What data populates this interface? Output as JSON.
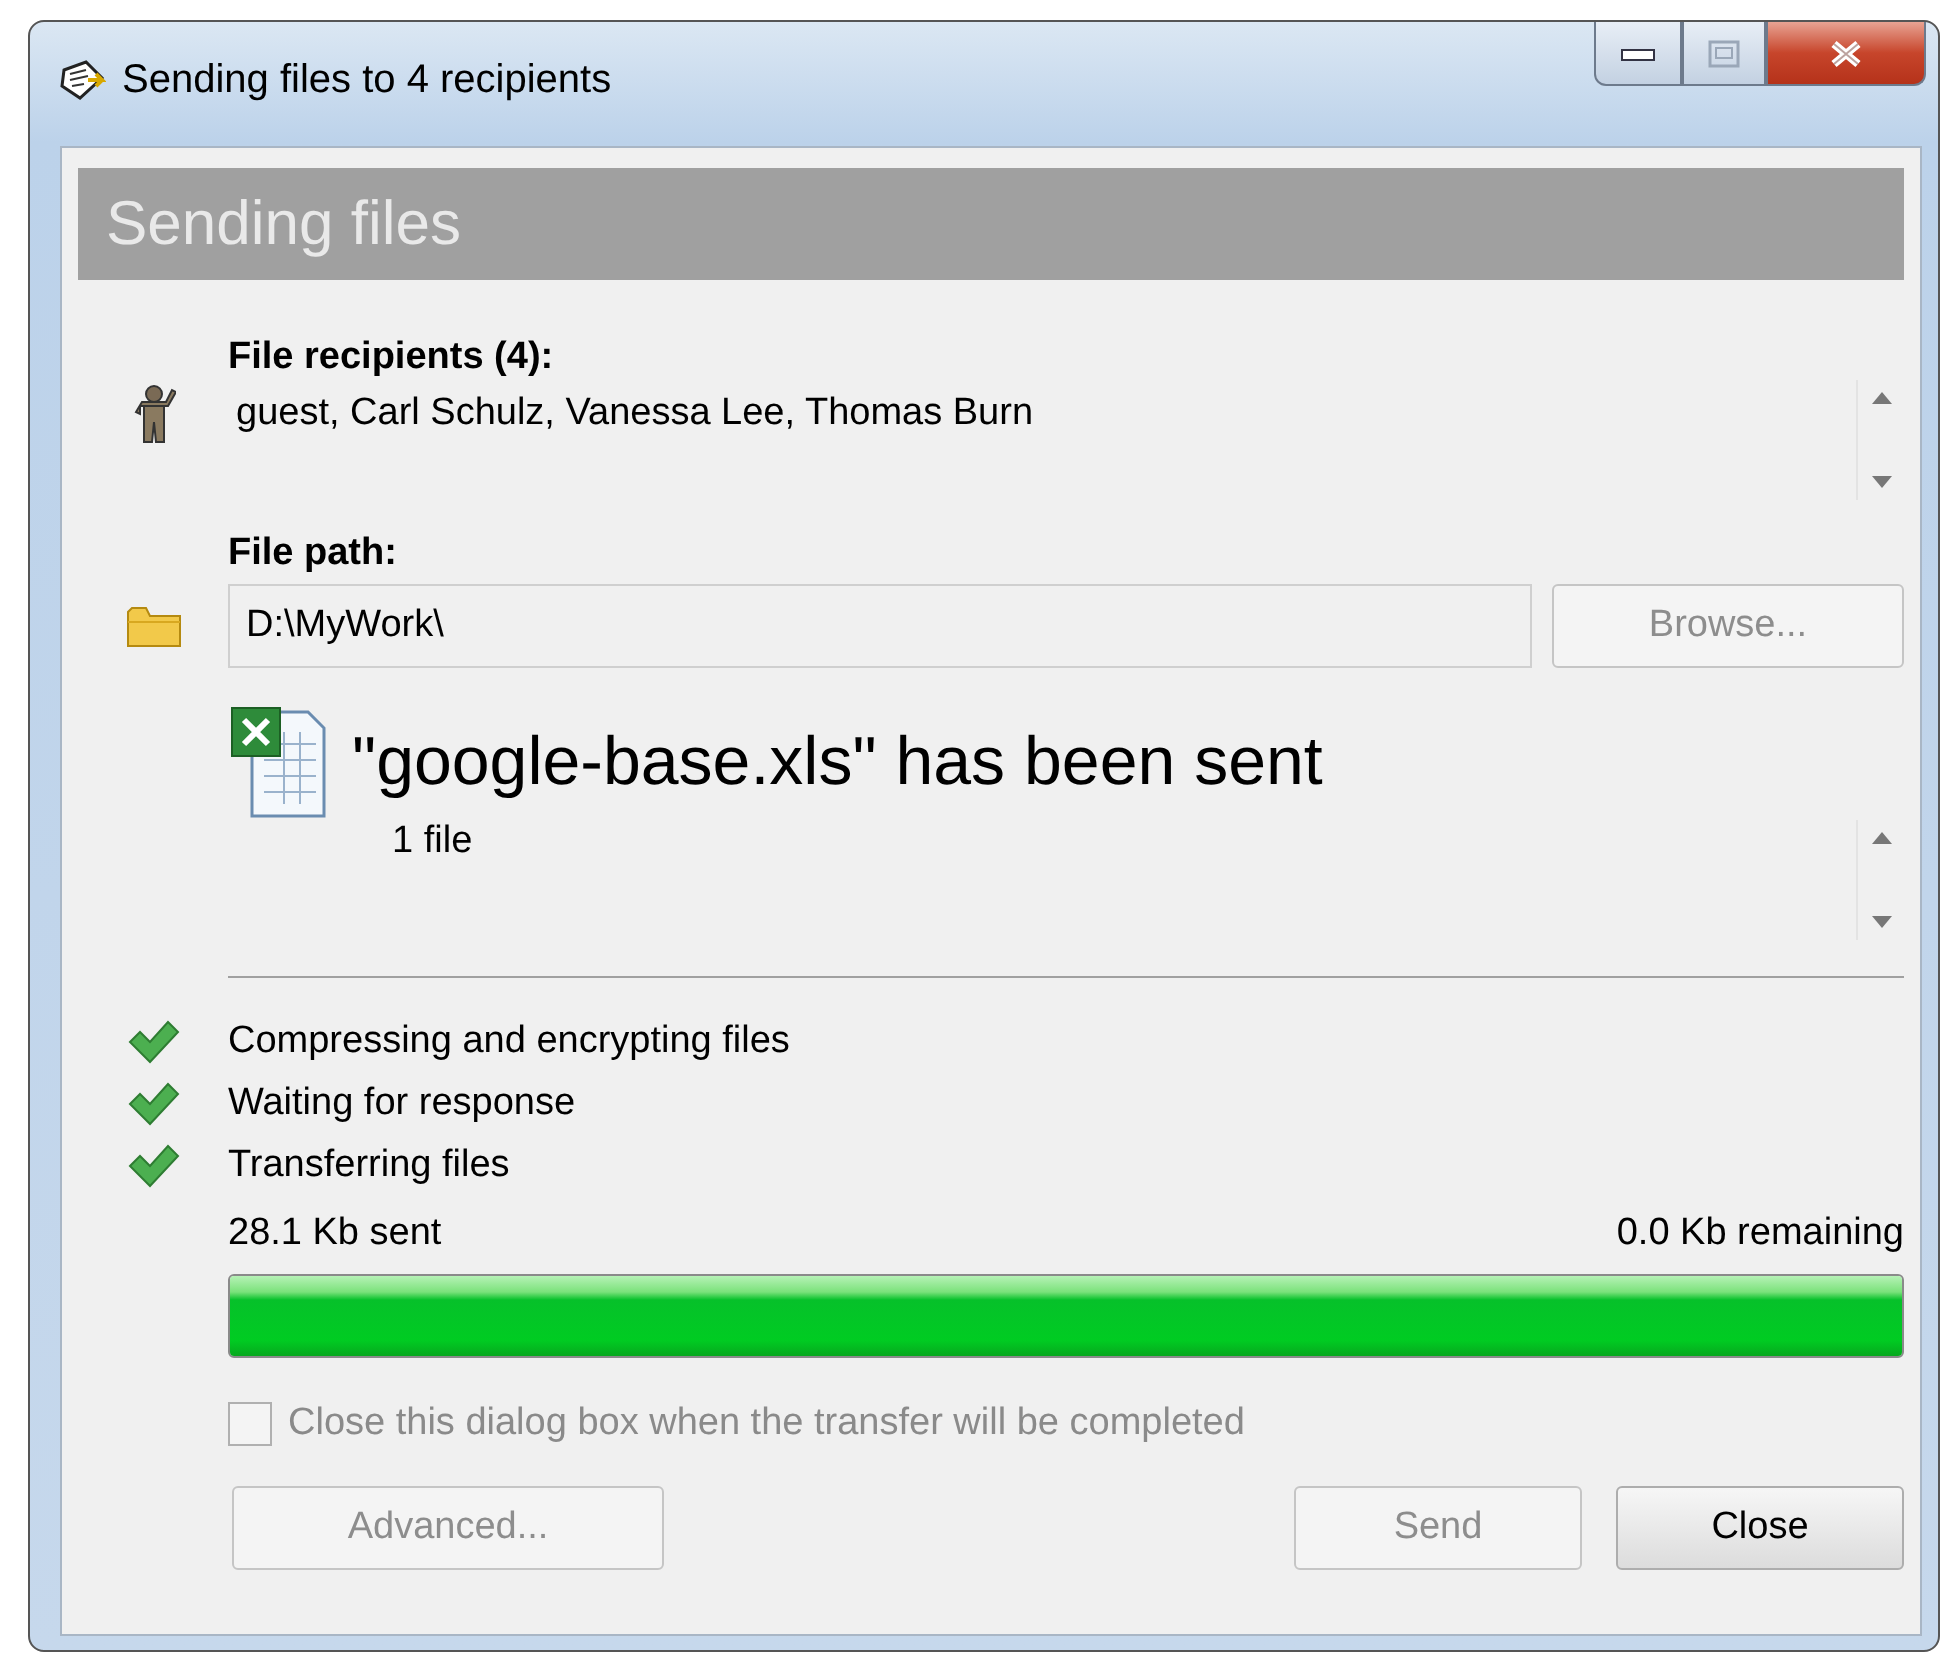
{
  "window": {
    "title": "Sending files to 4 recipients",
    "controls": [
      {
        "kind": "minimize"
      },
      {
        "kind": "maximize",
        "disabled": true
      },
      {
        "kind": "close"
      }
    ]
  },
  "header": {
    "title": "Sending files"
  },
  "recipients": {
    "label": "File recipients (4):",
    "names": "guest, Carl Schulz, Vanessa Lee, Thomas Burn"
  },
  "file_path": {
    "label": "File path:",
    "value": "D:\\MyWork\\",
    "browse_button": {
      "label": "Browse...",
      "disabled": true
    }
  },
  "sent_file": {
    "title": "\"google-base.xls\" has been sent",
    "count": "1 file"
  },
  "steps": [
    {
      "label": "Compressing and encrypting files",
      "done": true
    },
    {
      "label": "Waiting for response",
      "done": true
    },
    {
      "label": "Transferring files",
      "done": true
    }
  ],
  "progress": {
    "sent": "28.1 Kb sent",
    "remaining": "0.0 Kb remaining",
    "level": 1
  },
  "close_option": {
    "label": "Close this dialog box when the transfer will be completed",
    "checked": false,
    "disabled": true
  },
  "buttons": [
    {
      "label": "Advanced...",
      "disabled": true,
      "kind": "left"
    },
    {
      "label": "Send",
      "disabled": true,
      "kind": "right"
    },
    {
      "label": "Close",
      "disabled": false,
      "kind": "right"
    }
  ]
}
